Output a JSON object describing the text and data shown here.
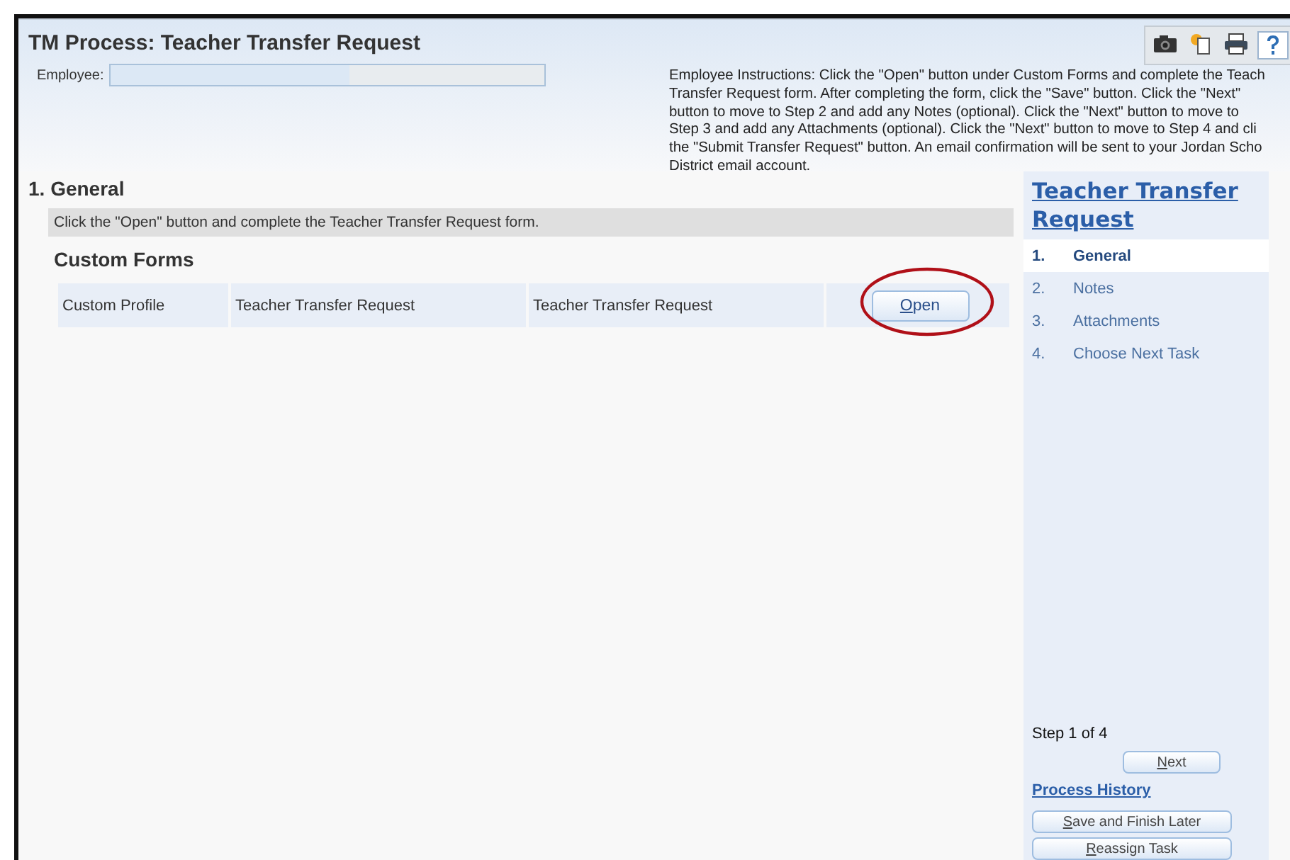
{
  "window": {
    "title": "TM Process: Teacher Transfer Request"
  },
  "employee": {
    "label": "Employee:"
  },
  "instructions": [
    "Employee Instructions: Click the \"Open\" button under Custom Forms and complete the Teach",
    "Transfer Request form. After completing the form, click the \"Save\" button. Click the \"Next\"",
    "button to move to Step 2 and add any Notes (optional). Click the \"Next\" button to move to",
    "Step 3 and add any Attachments (optional). Click the \"Next\" button to move to Step 4 and cli",
    "the \"Submit Transfer Request\" button. An email confirmation will be sent to your Jordan Scho",
    "District email account."
  ],
  "section": {
    "title": "1. General",
    "hint": "Click the \"Open\" button and complete the Teacher Transfer Request form."
  },
  "custom_forms": {
    "title": "Custom Forms",
    "rows": [
      {
        "cells": [
          "Custom Profile",
          "Teacher Transfer Request",
          "Teacher Transfer Request"
        ],
        "button": "Open",
        "highlighted": true
      }
    ]
  },
  "sidebar": {
    "title": "Teacher Transfer Request",
    "steps": [
      {
        "number": "1.",
        "label": "General",
        "selected": true
      },
      {
        "number": "2.",
        "label": "Notes",
        "selected": false
      },
      {
        "number": "3.",
        "label": "Attachments",
        "selected": false
      },
      {
        "number": "4.",
        "label": "Choose Next Task",
        "selected": false
      }
    ],
    "step_text": "Step 1 of 4",
    "next": "Next",
    "history": "Process History",
    "buttons": [
      "Save and Finish Later",
      "Reassign Task"
    ]
  }
}
